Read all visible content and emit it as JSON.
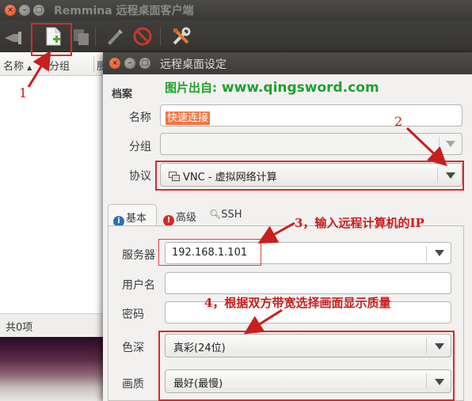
{
  "main_window": {
    "title": "Remmina 远程桌面客户端",
    "columns": [
      "名称",
      "分组",
      "服"
    ],
    "status": "共0项"
  },
  "toolbar": {
    "icons": [
      "connect-icon",
      "new-connection-icon",
      "copy-icon",
      "edit-icon",
      "delete-icon",
      "preferences-icon"
    ]
  },
  "dialog": {
    "title": "远程桌面设定",
    "section": "档案",
    "watermark_prefix": "图片出自:",
    "watermark_url": "www.qingsword.com",
    "name_label": "名称",
    "name_value": "快速连接",
    "group_label": "分组",
    "group_value": "",
    "protocol_label": "协议",
    "protocol_value": "VNC - 虚拟网络计算",
    "tabs": [
      "基本",
      "高级",
      "SSH"
    ],
    "server_label": "服务器",
    "server_value": "192.168.1.101",
    "username_label": "用户名",
    "username_value": "",
    "password_label": "密码",
    "password_value": "",
    "color_depth_label": "色深",
    "color_depth_value": "真彩(24位)",
    "quality_label": "画质",
    "quality_value": "最好(最慢)"
  },
  "annotations": {
    "n1": "1",
    "n2": "2",
    "n3": "3，输入远程计算机的IP",
    "n4": "4，根据双方带宽选择画面显示质量"
  },
  "colors": {
    "annotation_red": "#d92a2a",
    "watermark_green": "#1ea22c",
    "selection_orange": "#f07746"
  }
}
